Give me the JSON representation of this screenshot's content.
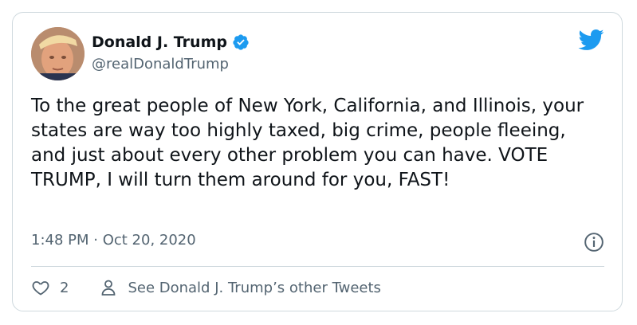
{
  "tweet": {
    "display_name": "Donald J. Trump",
    "handle": "@realDonaldTrump",
    "text": "To the great people of New York, California, and Illinois, your states are way too highly taxed, big crime, people fleeing, and just about every other problem you can have. VOTE TRUMP, I will turn them around for you, FAST!",
    "timestamp": "1:48 PM · Oct 20, 2020"
  },
  "actions": {
    "like_count": "2",
    "see_other_label": "See Donald J. Trump’s other Tweets"
  },
  "icons": {
    "avatar": "avatar",
    "verified": "verified-badge-icon",
    "logo": "twitter-bird-icon",
    "info": "info-icon",
    "like": "heart-icon",
    "profile": "person-icon"
  },
  "colors": {
    "brand_blue": "#1d9bf0",
    "text_primary": "#0f1419",
    "text_secondary": "#536471",
    "border": "#cfd9de"
  }
}
